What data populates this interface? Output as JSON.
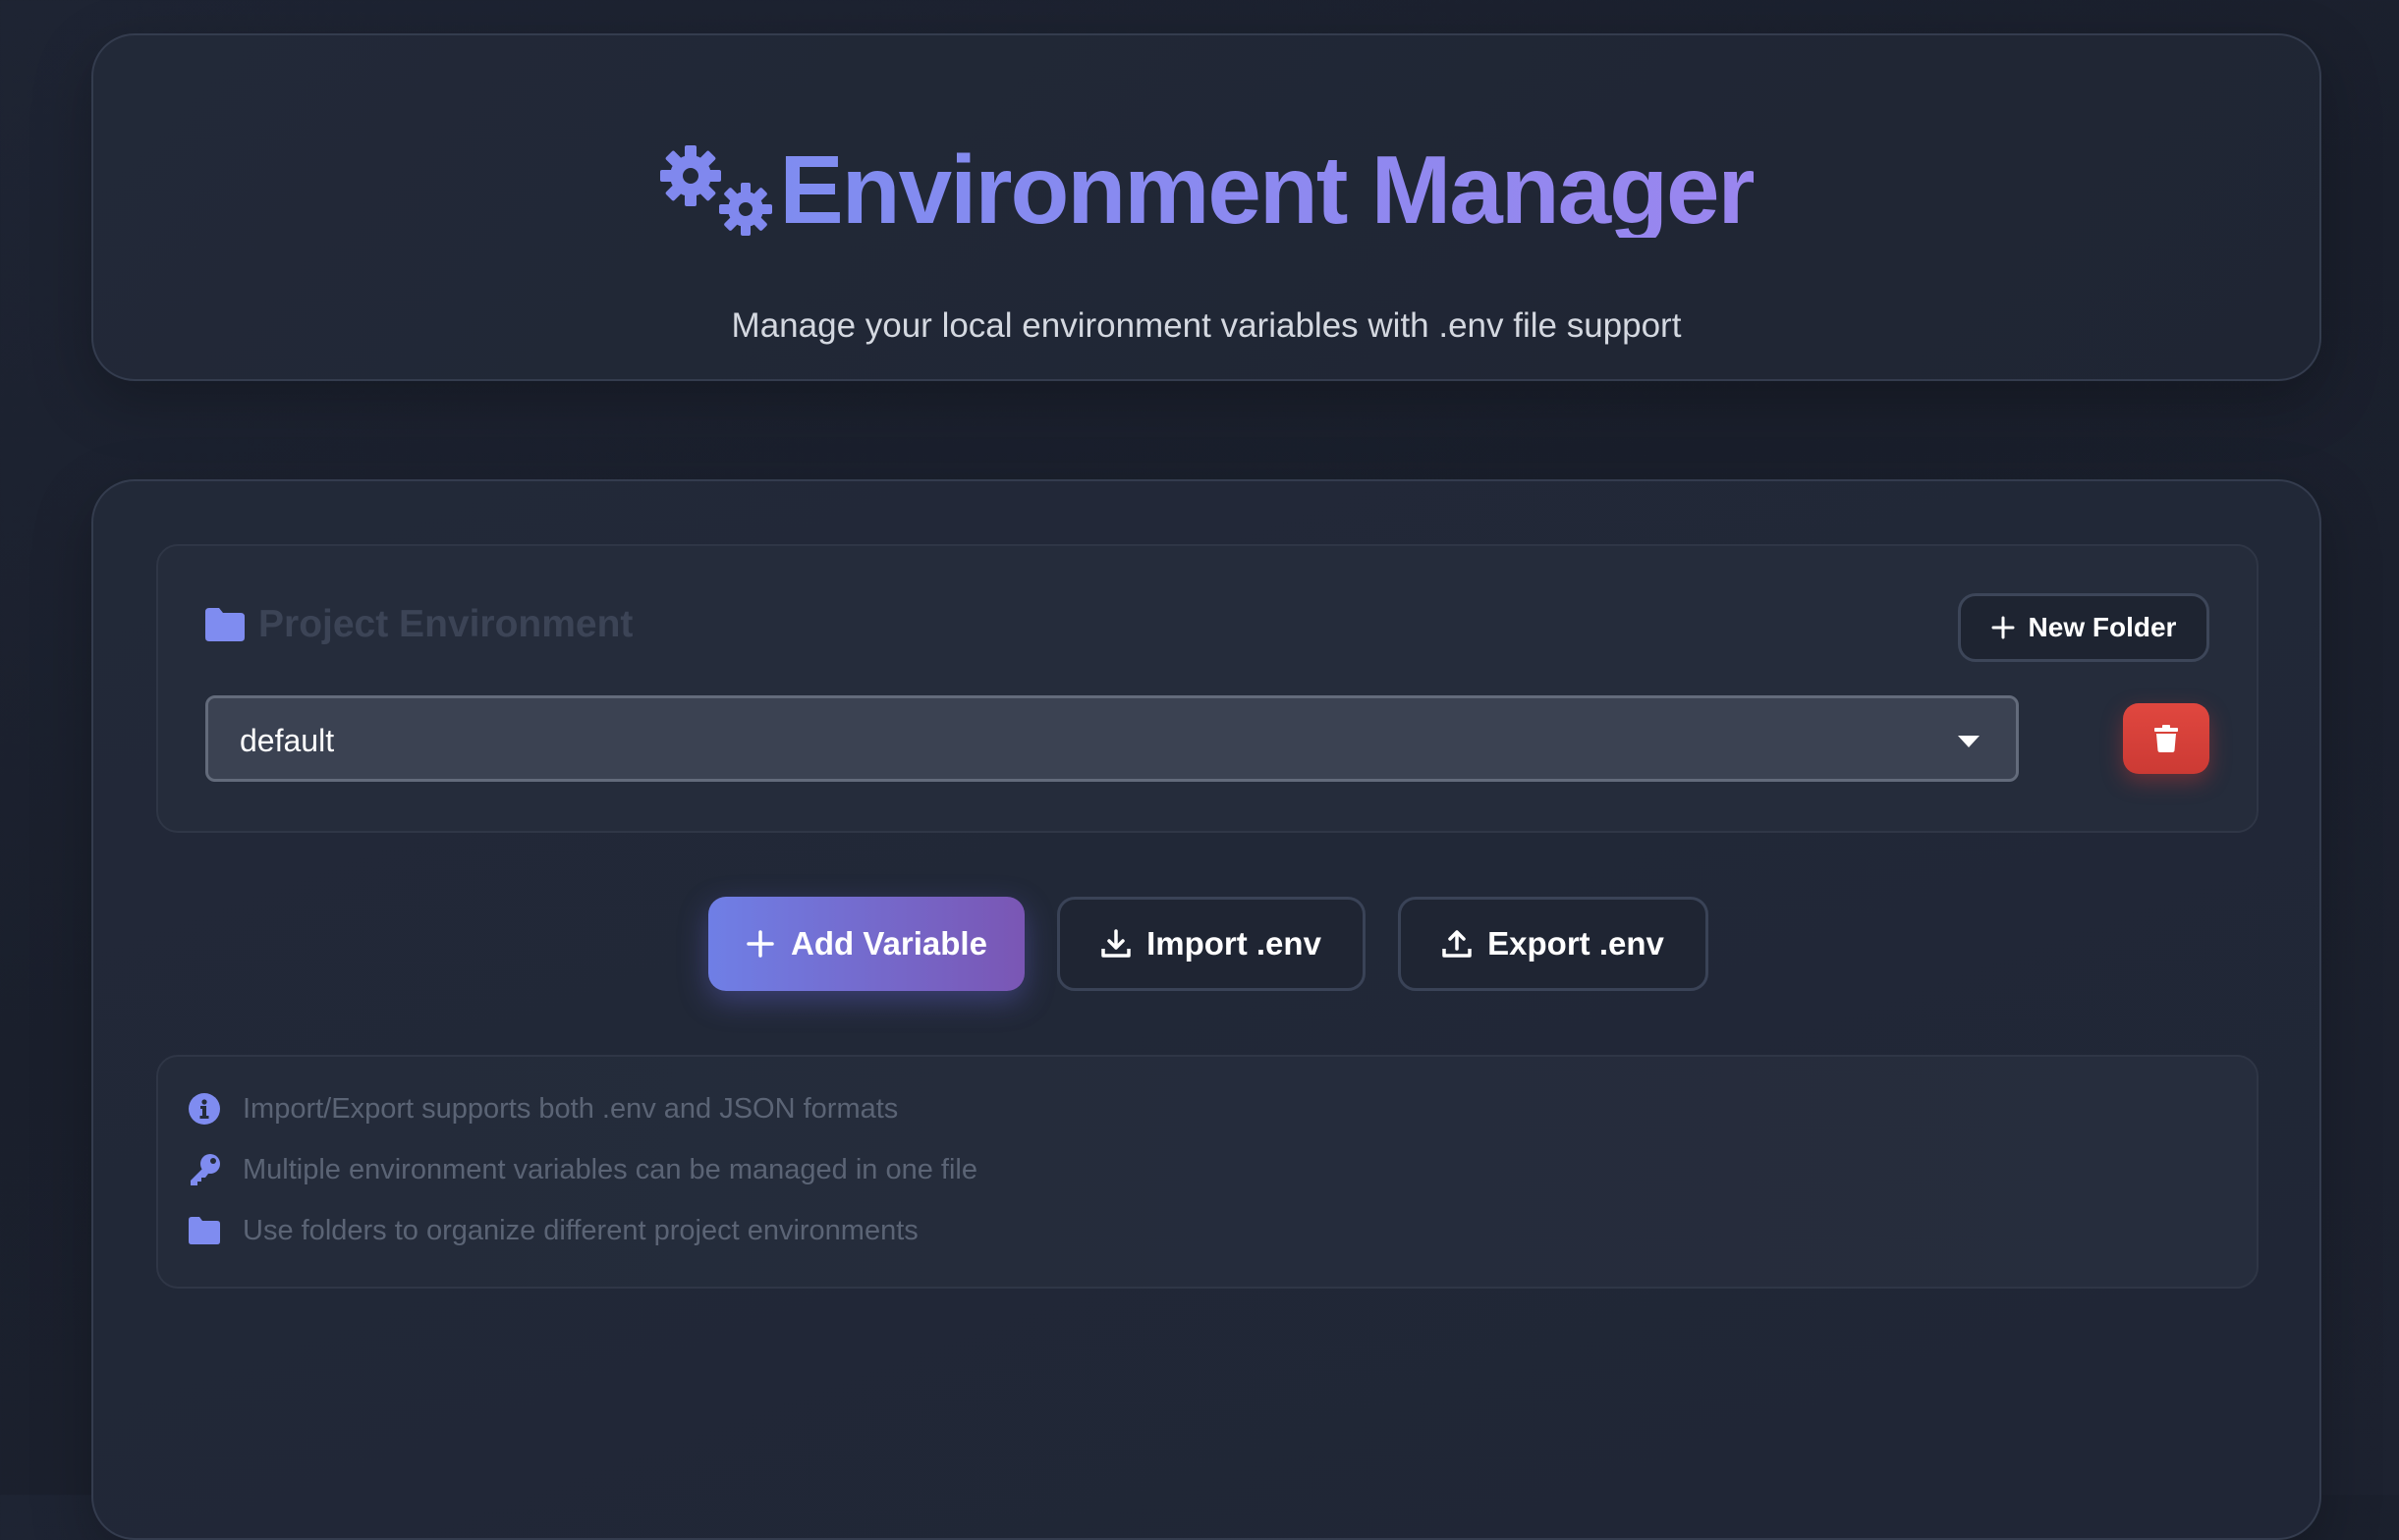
{
  "header": {
    "title": "Environment Manager",
    "subtitle": "Manage your local environment variables with .env file support",
    "title_icon": "gears-icon"
  },
  "environment_panel": {
    "title": "Project Environment",
    "title_icon": "folder-icon",
    "new_folder_label": "New Folder",
    "selected_folder": "default",
    "delete_icon": "trash-icon"
  },
  "actions": {
    "add_variable_label": "Add Variable",
    "import_label": "Import .env",
    "export_label": "Export .env"
  },
  "info": {
    "items": [
      {
        "icon": "info-circle-icon",
        "text": "Import/Export supports both .env and JSON formats"
      },
      {
        "icon": "key-icon",
        "text": "Multiple environment variables can be managed in one file"
      },
      {
        "icon": "folder-icon",
        "text": "Use folders to organize different project environments"
      }
    ]
  },
  "colors": {
    "accent": "#7f8cf0",
    "accent_purple": "#7a56b4",
    "danger": "#e0473f",
    "background": "#1e2433"
  }
}
